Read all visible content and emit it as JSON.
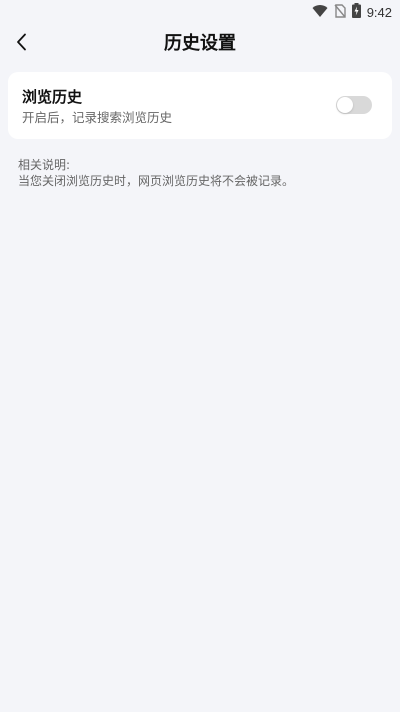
{
  "status_bar": {
    "time": "9:42",
    "icons": [
      "wifi-icon",
      "no-sim-icon",
      "battery-charging-icon"
    ]
  },
  "header": {
    "back_icon": "chevron-left-icon",
    "title": "历史设置"
  },
  "history_setting": {
    "title": "浏览历史",
    "subtitle": "开启后，记录搜索浏览历史",
    "toggle_on": false
  },
  "note": {
    "heading": "相关说明:",
    "body": "当您关闭浏览历史时，网页浏览历史将不会被记录。"
  },
  "colors": {
    "background": "#f4f5f9",
    "card": "#ffffff",
    "toggle_off": "#d9d9d9"
  }
}
